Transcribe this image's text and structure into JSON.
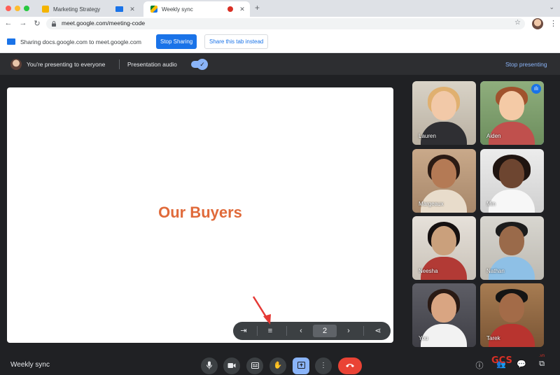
{
  "browser": {
    "tabs": [
      {
        "title": "Marketing Strategy",
        "active": false
      },
      {
        "title": "Weekly sync",
        "active": true
      }
    ],
    "url": "meet.google.com/meeting-code"
  },
  "share_bar": {
    "message": "Sharing docs.google.com to meet.google.com",
    "stop_label": "Stop Sharing",
    "share_tab_label": "Share this tab instead"
  },
  "presenting_bar": {
    "message": "You're presenting to everyone",
    "audio_label": "Presentation audio",
    "audio_enabled": true,
    "stop_label": "Stop presenting"
  },
  "slide": {
    "title": "Our Buyers",
    "title_color": "#e06a3a",
    "page_number": "2"
  },
  "participants": [
    {
      "name": "Lauren",
      "speaking": false
    },
    {
      "name": "Aiden",
      "speaking": true
    },
    {
      "name": "Margeaux",
      "speaking": false
    },
    {
      "name": "Min",
      "speaking": false
    },
    {
      "name": "Neesha",
      "speaking": false
    },
    {
      "name": "Nathan",
      "speaking": false
    },
    {
      "name": "You",
      "speaking": false
    },
    {
      "name": "Tarek",
      "speaking": false
    }
  ],
  "meeting": {
    "name": "Weekly sync"
  },
  "watermark": {
    "text": "GCS",
    "suffix": ".vn"
  },
  "colors": {
    "accent": "#1a73e8",
    "accent_light": "#8ab4f8",
    "end_call": "#ea4335",
    "annotation_arrow": "#e53935"
  }
}
